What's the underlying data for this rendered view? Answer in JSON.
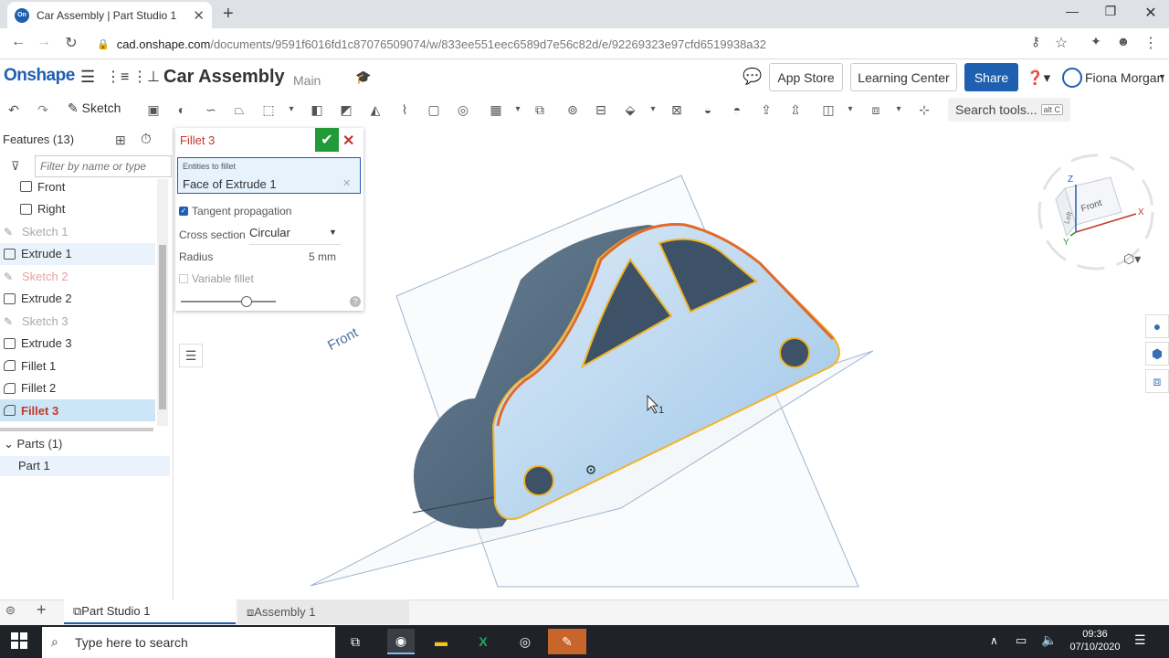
{
  "browser": {
    "tab_title": "Car Assembly | Part Studio 1",
    "favicon_text": "On",
    "url_host": "cad.onshape.com",
    "url_path": "/documents/9591f6016fd1c87076509074/w/833ee551eec6589d7e56c82d/e/92269323e97cfd6519938a32"
  },
  "header": {
    "logo": "Onshape",
    "doc_title": "Car Assembly",
    "branch": "Main",
    "app_store": "App Store",
    "learning_center": "Learning Center",
    "share": "Share",
    "user": "Fiona Morgan",
    "accent": "#1f5fb0"
  },
  "toolbar": {
    "sketch": "Sketch",
    "search_tools": "Search tools...",
    "shortcut": "alt C"
  },
  "features": {
    "title": "Features (13)",
    "filter_placeholder": "Filter by name or type",
    "items": [
      {
        "label": "Front",
        "kind": "plane"
      },
      {
        "label": "Right",
        "kind": "plane"
      },
      {
        "label": "Sketch 1",
        "kind": "sketch"
      },
      {
        "label": "Extrude 1",
        "kind": "extrude"
      },
      {
        "label": "Sketch 2",
        "kind": "sketch"
      },
      {
        "label": "Extrude 2",
        "kind": "extrude"
      },
      {
        "label": "Sketch 3",
        "kind": "sketch"
      },
      {
        "label": "Extrude 3",
        "kind": "extrude"
      },
      {
        "label": "Fillet 1",
        "kind": "fillet"
      },
      {
        "label": "Fillet 2",
        "kind": "fillet"
      },
      {
        "label": "Fillet 3",
        "kind": "fillet"
      }
    ],
    "parts_header": "Parts (1)",
    "part": "Part 1"
  },
  "fillet_dialog": {
    "title": "Fillet 3",
    "entities_label": "Entities to fillet",
    "entities_value": "Face of Extrude 1",
    "tangent": "Tangent propagation",
    "cross_section_label": "Cross section",
    "cross_section_value": "Circular",
    "radius_label": "Radius",
    "radius_value": "5 mm",
    "variable": "Variable fillet"
  },
  "viewport": {
    "plane_label": "Front",
    "cube_face": "Front",
    "cube_left": "Left",
    "axis_x": "X",
    "axis_y": "Y",
    "axis_z": "Z",
    "cursor_count": "1"
  },
  "bottom_tabs": {
    "part_studio": "Part Studio 1",
    "assembly": "Assembly 1"
  },
  "taskbar": {
    "search_placeholder": "Type here to search",
    "time": "09:36",
    "date": "07/10/2020"
  }
}
